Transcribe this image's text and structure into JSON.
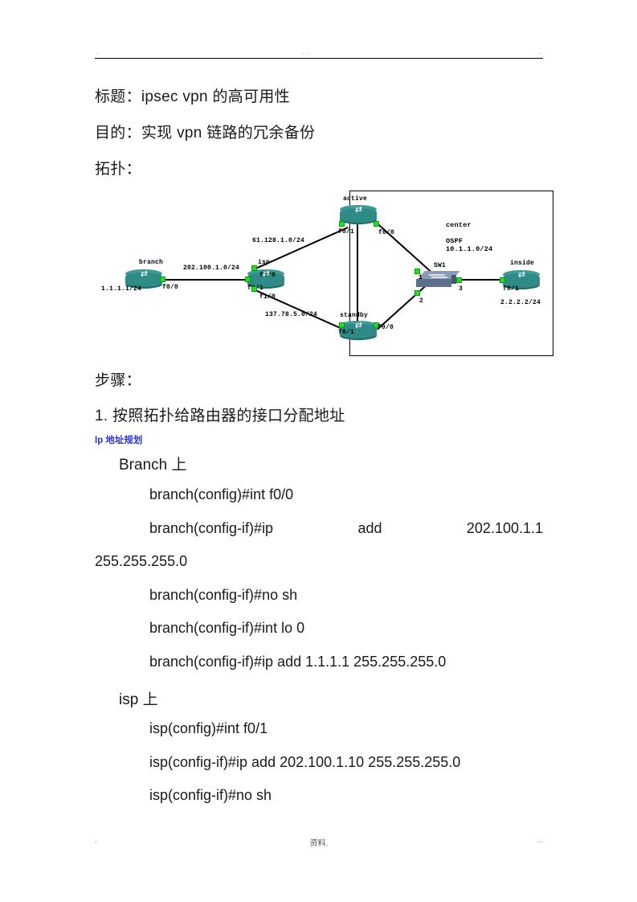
{
  "header": {
    "mark_left": ".",
    "mark_center": ". .",
    "mark_right": "."
  },
  "footer": {
    "left": ".",
    "center": "资料.",
    "right": ".."
  },
  "document": {
    "title_line": "标题：ipsec vpn 的高可用性",
    "purpose_line": "目的：实现 vpn 链路的冗余备份",
    "topology_line": "拓扑：",
    "steps_line": "步骤：",
    "step1": "1. 按照拓扑给路由器的接口分配地址",
    "ip_plan_note": "Ip 地址规划",
    "branch_header": "Branch 上",
    "isp_header": "isp 上"
  },
  "branch_commands": [
    "branch(config)#int f0/0",
    "branch(config-if)#no sh",
    "branch(config-if)#int lo 0",
    "branch(config-if)#ip add 1.1.1.1 255.255.255.0"
  ],
  "branch_justified": {
    "part1": "branch(config-if)#ip",
    "part2": "add",
    "part3": "202.100.1.1",
    "wrapped": "255.255.255.0"
  },
  "isp_commands": [
    "isp(config)#int f0/1",
    "isp(config-if)#ip add 202.100.1.10 255.255.255.0",
    "isp(config-if)#no sh"
  ],
  "topology": {
    "nodes": {
      "branch": "branch",
      "isp": "isp",
      "active": "active",
      "standby": "standby",
      "sw1": "SW1",
      "inside": "inside"
    },
    "center_block": {
      "name": "center",
      "protocol": "OSPF",
      "subnet": "10.1.1.0/24"
    },
    "labels": {
      "branch_lo": "1.1.1.1/24",
      "branch_f00": "f0/0",
      "link_branch_isp": "202.100.1.0/24",
      "isp_f01": "f0/1",
      "isp_f00": "f0/0",
      "isp_f10": "f1/0",
      "link_isp_active": "61.128.1.0/24",
      "link_isp_standby": "137.78.5.0/24",
      "active_f01": "f0/1",
      "active_f00": "f0/0",
      "standby_f01": "f0/1",
      "standby_f00": "f0/0",
      "sw_port1": "1",
      "sw_port2": "2",
      "sw_port3": "3",
      "inside_f01": "f0/1",
      "inside_ip": "2.2.2.2/24"
    }
  },
  "colors": {
    "router_body": "#2e8b86",
    "port_dot": "#22dd22",
    "switch_body": "#5d6f8c",
    "note_blue": "#2b36c8"
  }
}
